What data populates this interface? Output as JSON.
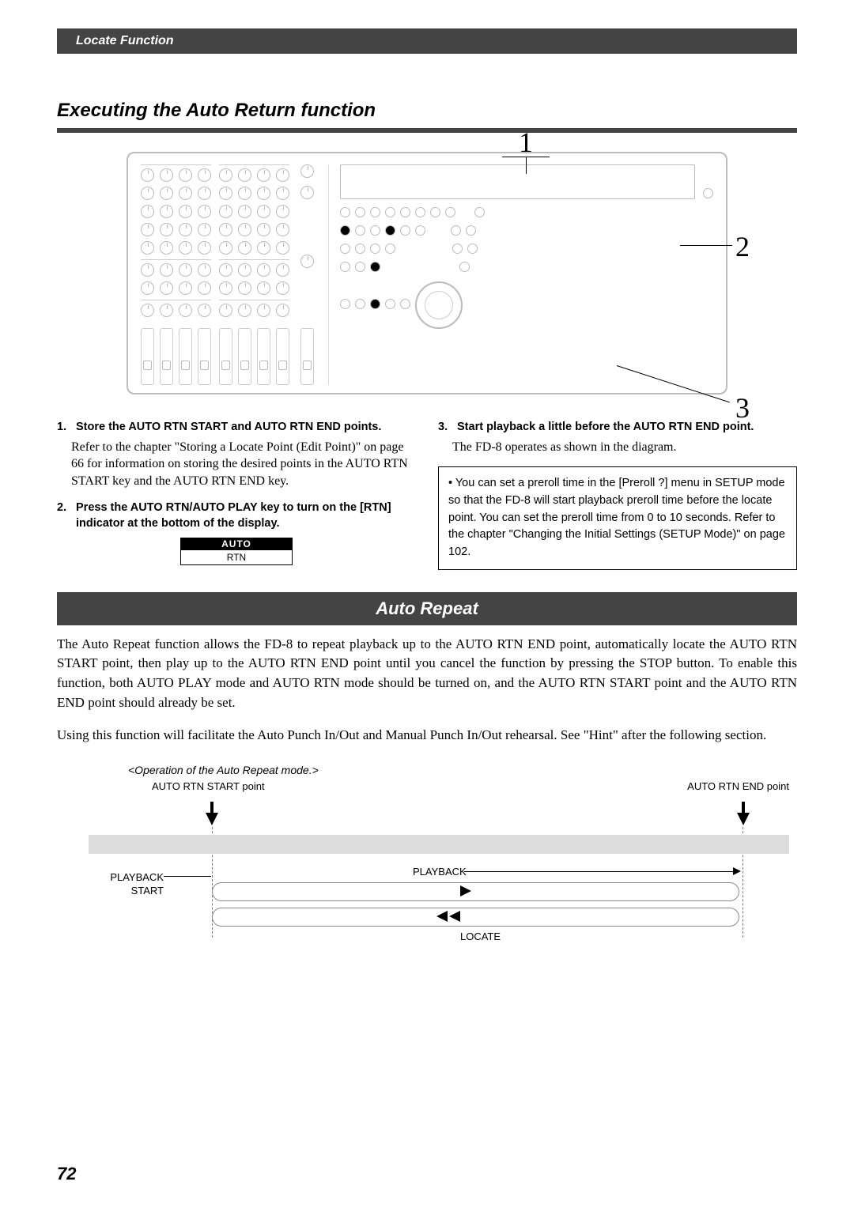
{
  "header": {
    "chapter": "Locate Function"
  },
  "section_title": "Executing the Auto Return function",
  "callouts": {
    "n1": "1",
    "n2": "2",
    "n3": "3"
  },
  "steps": {
    "s1": {
      "num": "1.",
      "title": "Store the AUTO RTN START and AUTO RTN END points.",
      "body": "Refer to the chapter \"Storing a Locate Point (Edit Point)\" on page 66 for information on storing the desired points in the AUTO RTN START key and the AUTO RTN END key."
    },
    "s2": {
      "num": "2.",
      "title": "Press the AUTO RTN/AUTO PLAY key to turn on the [RTN] indicator at the bottom of the display."
    },
    "s3": {
      "num": "3.",
      "title": "Start playback a little before the AUTO RTN END point.",
      "body": "The FD-8 operates as shown in the diagram."
    }
  },
  "rtn_indicator": {
    "top": "AUTO",
    "bottom": "RTN"
  },
  "note": "• You can set a preroll time in the [Preroll ?] menu in SETUP mode so that the FD-8 will start playback preroll time before the locate point. You can set the preroll time from 0 to 10 seconds. Refer to the chapter \"Changing the Initial Settings (SETUP Mode)\" on page 102.",
  "auto_repeat": {
    "title": "Auto Repeat",
    "para": "The Auto Repeat function allows the FD-8 to repeat playback up to the AUTO RTN END point, automatically locate the AUTO RTN START point, then play up to the AUTO RTN END point until you cancel the function by pressing the STOP button.  To enable this function, both AUTO PLAY mode and AUTO RTN mode should be turned on, and the AUTO RTN START point and the AUTO RTN END point should already be set.",
    "para2": "Using this function will facilitate the Auto Punch In/Out and Manual Punch In/Out rehearsal. See \"Hint\" after the following section."
  },
  "diagram": {
    "caption": "<Operation of the Auto Repeat mode.>",
    "start_label": "AUTO RTN START point",
    "end_label": "AUTO RTN END point",
    "playback_start": "PLAYBACK\nSTART",
    "playback": "PLAYBACK",
    "locate": "LOCATE"
  },
  "page_number": "72"
}
